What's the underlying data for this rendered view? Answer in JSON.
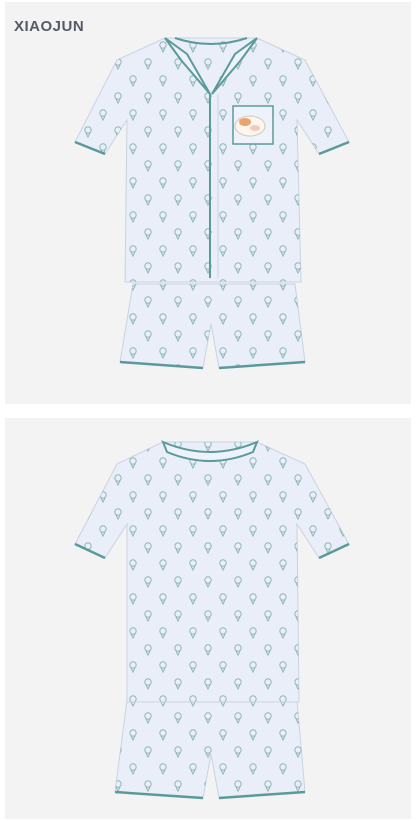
{
  "brand": {
    "name": "XIAOJUN"
  },
  "colors": {
    "background": "#ffffff",
    "panel": "#f3f3f3",
    "fabric": "#e9eef8",
    "piping": "#5a9a9a",
    "motif": "#8fb7b8"
  },
  "images": [
    {
      "view": "front",
      "icon": "pajama-set-front"
    },
    {
      "view": "back",
      "icon": "pajama-set-back"
    }
  ]
}
